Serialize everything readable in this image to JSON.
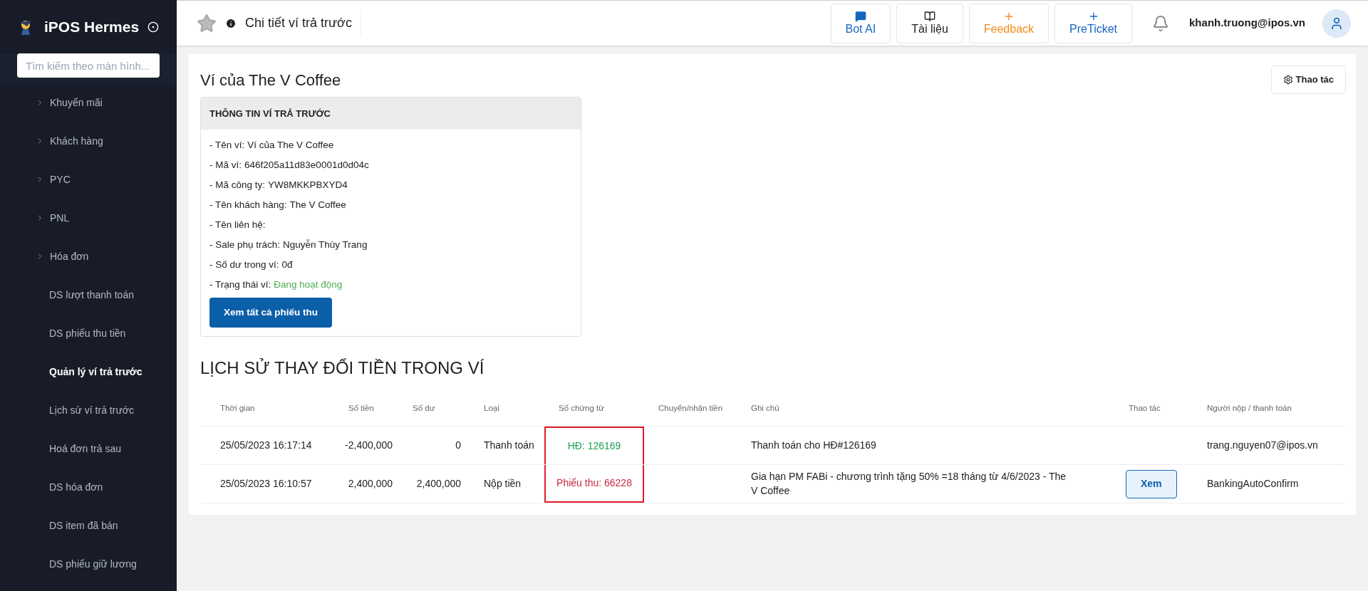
{
  "brand": {
    "name": "iPOS Hermes"
  },
  "sidebar": {
    "search": {
      "placeholder": "Tìm kiếm theo màn hình..."
    },
    "items": [
      {
        "label": "Khuyến mãi",
        "kind": "group",
        "selected": false
      },
      {
        "label": "Khách hàng",
        "kind": "group",
        "selected": false
      },
      {
        "label": "PYC",
        "kind": "group",
        "selected": false
      },
      {
        "label": "PNL",
        "kind": "group",
        "selected": false
      },
      {
        "label": "Hóa đơn",
        "kind": "group",
        "selected": false
      },
      {
        "label": "DS lượt thanh toán",
        "kind": "leaf",
        "selected": false
      },
      {
        "label": "DS phiếu thu tiền",
        "kind": "leaf",
        "selected": false
      },
      {
        "label": "Quản lý ví trả trước",
        "kind": "leaf",
        "selected": true
      },
      {
        "label": "Lịch sử ví trả trước",
        "kind": "leaf",
        "selected": false
      },
      {
        "label": "Hoá đơn trả sau",
        "kind": "leaf",
        "selected": false
      },
      {
        "label": "DS hóa đơn",
        "kind": "leaf",
        "selected": false
      },
      {
        "label": "DS item đã bán",
        "kind": "leaf",
        "selected": false
      },
      {
        "label": "DS phiếu giữ lương",
        "kind": "leaf",
        "selected": false
      }
    ]
  },
  "header": {
    "title": "Chi tiết ví trả trước",
    "buttons": [
      {
        "label": "Bot AI",
        "kind": "chat"
      },
      {
        "label": "Tài liệu",
        "kind": "docs"
      },
      {
        "label": "Feedback",
        "kind": "plus-orange"
      },
      {
        "label": "PreTicket",
        "kind": "plus-blue"
      }
    ],
    "user": "khanh.truong@ipos.vn"
  },
  "page": {
    "title": "Ví của The V Coffee",
    "action": "Thao tác",
    "info_card": {
      "title": "THÔNG TIN VÍ TRẢ TRƯỚC",
      "lines": [
        {
          "label": "- Tên ví:",
          "value": "Ví của The V Coffee"
        },
        {
          "label": "- Mã ví:",
          "value": "646f205a11d83e0001d0d04c"
        },
        {
          "label": "- Mã công ty:",
          "value": "YW8MKKPBXYD4"
        },
        {
          "label": "- Tên khách hàng:",
          "value": "The V Coffee"
        },
        {
          "label": "- Tên liên hệ:"
        },
        {
          "label": "- Sale phụ trách:",
          "value": "Nguyễn Thùy Trang"
        },
        {
          "label": "- Số dư trong ví:",
          "value": "0đ"
        },
        {
          "label": "- Trạng thái ví:",
          "value": "Đang hoạt động",
          "kind": "status"
        }
      ],
      "button": "Xem tất cả phiếu thu"
    },
    "history": {
      "title": "LỊCH SỬ THAY ĐỔI TIỀN TRONG VÍ",
      "highlight_vouchers": true,
      "columns": [
        "Thời gian",
        "Số tiền",
        "Số dư",
        "Loại",
        "Số chứng từ",
        "Chuyển/nhận tiền",
        "Ghi chú",
        "Thao tác",
        "Người nộp / thanh toán"
      ],
      "rows": [
        {
          "time": "25/05/2023 16:17:14",
          "amount": "-2,400,000",
          "balance": "0",
          "type": "Thanh toán",
          "voucher": {
            "text": "HĐ: 126169",
            "kind": "invoice"
          },
          "note": "Thanh toán cho HĐ#126169",
          "payer": "trang.nguyen07@ipos.vn"
        },
        {
          "time": "25/05/2023 16:10:57",
          "amount": "2,400,000",
          "balance": "2,400,000",
          "type": "Nộp tiền",
          "voucher": {
            "text": "Phiếu thu: 66228",
            "kind": "receipt"
          },
          "note": "Gia hạn PM FABi - chương trình tặng 50% =18 tháng từ 4/6/2023 - The V Coffee",
          "action": "Xem",
          "payer": "BankingAutoConfirm"
        }
      ]
    }
  }
}
